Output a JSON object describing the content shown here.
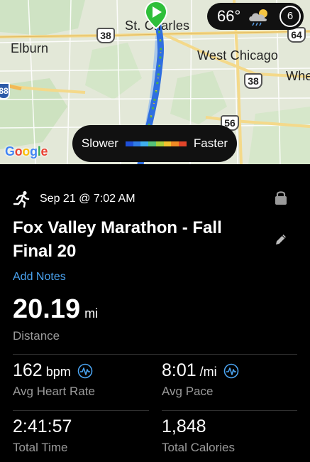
{
  "map": {
    "labels": {
      "st_charles": "St. Charles",
      "elburn": "Elburn",
      "west_chicago": "West Chicago",
      "wheaton_partial": "Whe"
    },
    "route_shields": {
      "r38_left": "38",
      "r38_right": "38",
      "r64": "64",
      "r56": "56",
      "i88": "88"
    },
    "google_logo": [
      "G",
      "o",
      "o",
      "g",
      "l",
      "e"
    ],
    "weather": {
      "temp": "66°",
      "aqi": "6",
      "icon": "cloud-sun-rain-icon"
    },
    "legend": {
      "slower_label": "Slower",
      "faster_label": "Faster",
      "colors": [
        "#1e4fd8",
        "#2f7be6",
        "#3fb0ef",
        "#55c27a",
        "#a8cf3c",
        "#f2c22e",
        "#f08a24",
        "#e2452a"
      ]
    },
    "route_color": "#2f6fe0",
    "start_pin_color": "#2fbf3a"
  },
  "activity": {
    "type_icon": "running-person-icon",
    "date": "Sep 21 @ 7:02 AM",
    "title": "Fox Valley Marathon - Fall Final 20",
    "add_notes": "Add Notes",
    "distance": {
      "value": "20.19",
      "unit": "mi",
      "label": "Distance"
    },
    "heart_rate": {
      "value": "162",
      "unit": "bpm",
      "label": "Avg Heart Rate"
    },
    "pace": {
      "value": "8:01",
      "unit": "/mi",
      "label": "Avg Pace"
    },
    "total_time": {
      "value": "2:41:57",
      "label": "Total Time"
    },
    "calories": {
      "value": "1,848",
      "label": "Total Calories"
    }
  }
}
